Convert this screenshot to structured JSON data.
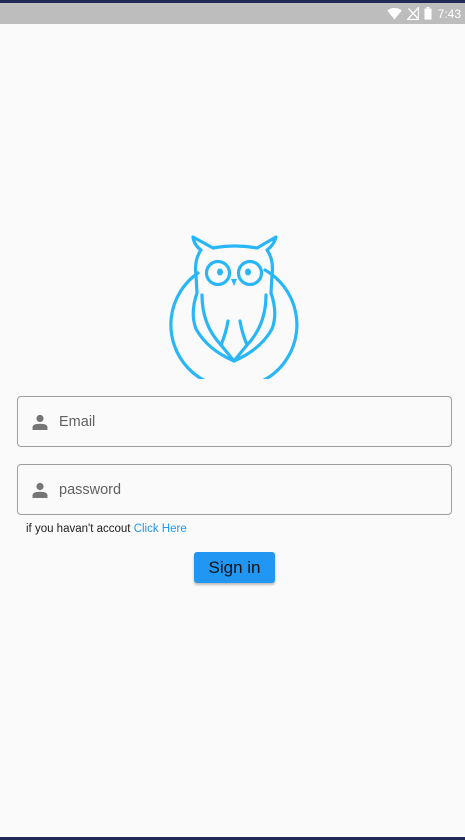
{
  "status_bar": {
    "time": "7:43",
    "icons": [
      "wifi-icon",
      "no-signal-icon",
      "battery-icon"
    ]
  },
  "logo": {
    "icon": "owl-logo-icon",
    "color": "#29b6f6"
  },
  "form": {
    "email_placeholder": "Email",
    "password_placeholder": "password",
    "field_icon": "person-icon",
    "signup_prompt": "if you havan't accout ",
    "signup_link": "Click Here",
    "signin_label": "Sign in"
  },
  "colors": {
    "accent": "#2196f3",
    "logo": "#29b6f6",
    "status_bar": "#bdbdbd",
    "field_border": "#9e9e9e"
  }
}
